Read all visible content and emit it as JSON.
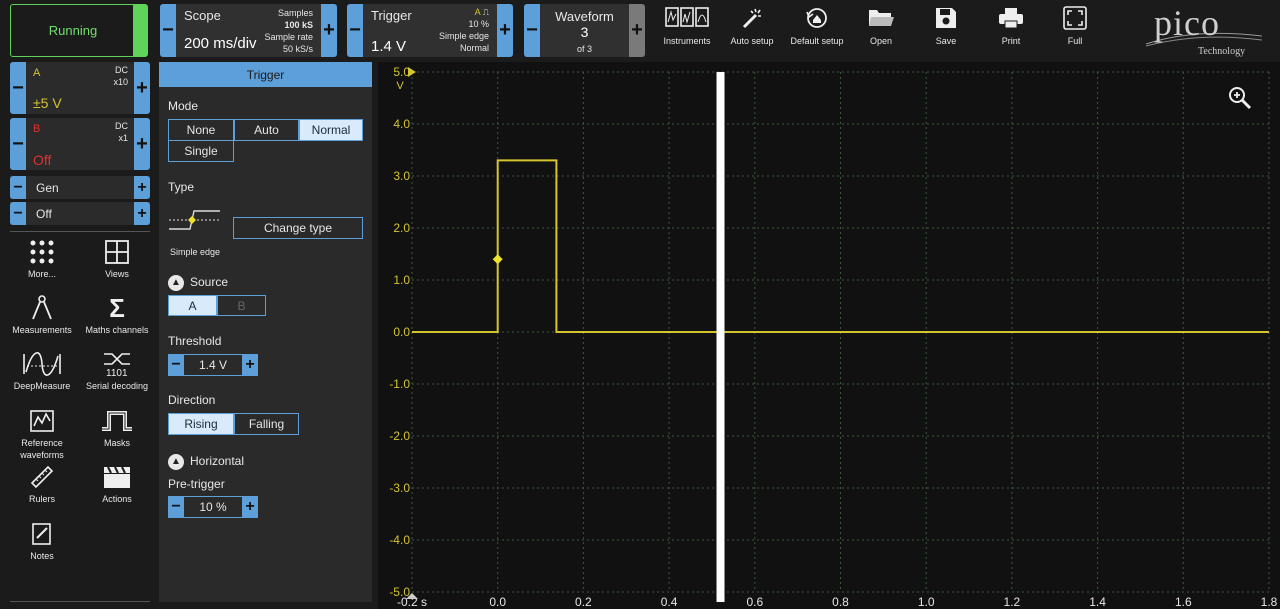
{
  "run": {
    "label": "Running"
  },
  "scope": {
    "title": "Scope",
    "value": "200 ms/div",
    "samples_label": "Samples",
    "samples_value": "100 kS",
    "rate_label": "Sample rate",
    "rate_value": "50 kS/s"
  },
  "trigger_ctl": {
    "title": "Trigger",
    "value": "1.4 V",
    "channel": "A",
    "pct": "10 %",
    "type": "Simple edge",
    "mode": "Normal"
  },
  "waveform": {
    "title": "Waveform",
    "value": "3",
    "of": "of 3"
  },
  "toolbar": [
    {
      "label": "Instruments",
      "icon": "instruments-icon"
    },
    {
      "label": "Auto setup",
      "icon": "magic-wand-icon"
    },
    {
      "label": "Default setup",
      "icon": "reset-icon"
    },
    {
      "label": "Open",
      "icon": "folder-icon"
    },
    {
      "label": "Save",
      "icon": "save-icon"
    },
    {
      "label": "Print",
      "icon": "printer-icon"
    },
    {
      "label": "Full",
      "icon": "fullscreen-icon"
    }
  ],
  "logo": {
    "name": "pico",
    "sub": "Technology"
  },
  "channels": {
    "a": {
      "name": "A",
      "coupling": "DC",
      "probe": "x10",
      "range": "±5 V",
      "color": "#d4c430"
    },
    "b": {
      "name": "B",
      "coupling": "DC",
      "probe": "x1",
      "range": "Off",
      "color": "#e03030"
    },
    "gen": {
      "label": "Gen",
      "state": "Off"
    }
  },
  "tools": [
    {
      "label": "More...",
      "icon": "more-grid-icon"
    },
    {
      "label": "Views",
      "icon": "views-icon"
    },
    {
      "label": "Measurements",
      "icon": "measurements-icon"
    },
    {
      "label": "Maths channels",
      "icon": "sigma-icon"
    },
    {
      "label": "DeepMeasure",
      "icon": "deepmeasure-icon"
    },
    {
      "label": "Serial decoding",
      "icon": "serial-decoding-icon"
    },
    {
      "label": "Reference waveforms",
      "icon": "reference-waveforms-icon"
    },
    {
      "label": "Masks",
      "icon": "masks-icon"
    },
    {
      "label": "Rulers",
      "icon": "ruler-icon"
    },
    {
      "label": "Actions",
      "icon": "clapper-icon"
    },
    {
      "label": "Notes",
      "icon": "notes-icon"
    }
  ],
  "panel": {
    "title": "Trigger",
    "mode_label": "Mode",
    "modes": [
      "None",
      "Auto",
      "Normal",
      "Single"
    ],
    "mode_selected": "Normal",
    "type_label": "Type",
    "type_name": "Simple edge",
    "change_type": "Change type",
    "source_label": "Source",
    "sources": [
      "A",
      "B"
    ],
    "threshold_label": "Threshold",
    "threshold": "1.4 V",
    "direction_label": "Direction",
    "directions": [
      "Rising",
      "Falling"
    ],
    "horizontal_label": "Horizontal",
    "pretrigger_label": "Pre-trigger",
    "pretrigger": "10 %"
  },
  "chart_data": {
    "type": "line",
    "ylabel": "V",
    "y_ticks": [
      "5.0",
      "4.0",
      "3.0",
      "2.0",
      "1.0",
      "0.0",
      "-1.0",
      "-2.0",
      "-3.0",
      "-4.0",
      "-5.0"
    ],
    "x_ticks": [
      "-0.2",
      "0.0",
      "0.2",
      "0.4",
      "0.6",
      "0.8",
      "1.0",
      "1.2",
      "1.4",
      "1.6",
      "1.8"
    ],
    "x_unit": "s",
    "xlim": [
      -0.2,
      1.8
    ],
    "ylim": [
      -5,
      5
    ],
    "series": [
      {
        "color": "#d4c430",
        "x": [
          -0.2,
          0.0,
          0.0,
          0.137,
          0.137,
          1.8
        ],
        "y": [
          0,
          0,
          3.3,
          3.3,
          0,
          0
        ]
      }
    ],
    "trigger_marker": {
      "x": 0.0,
      "y": 1.4
    },
    "cursor_x": 0.52,
    "grid": true
  }
}
